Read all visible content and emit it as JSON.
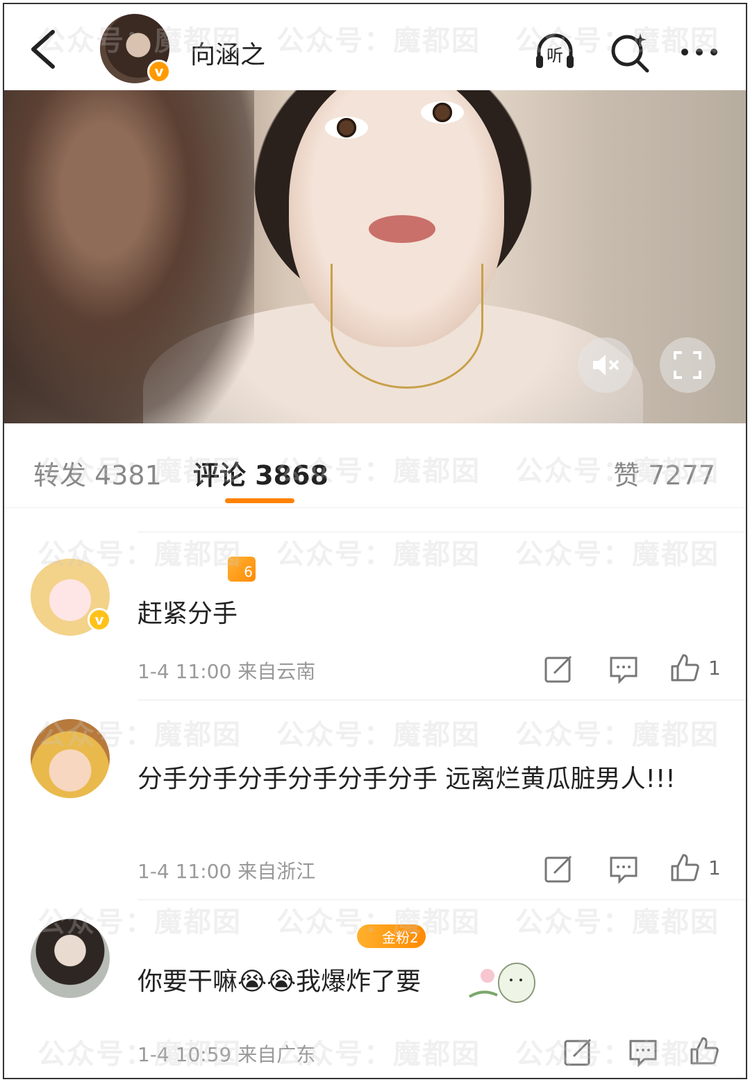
{
  "header": {
    "title": "向涵之",
    "verified_badge": "v",
    "listen_label": "听",
    "icons": [
      "back-chevron-icon",
      "listen-headphone-icon",
      "search-sparkle-icon",
      "more-dots-icon"
    ]
  },
  "video": {
    "controls": [
      "mute-icon",
      "fullscreen-icon"
    ]
  },
  "tabs": {
    "repost": "转发 4381",
    "comments": "评论 3868",
    "likes": "赞 7277"
  },
  "comments": [
    {
      "text": "赶紧分手",
      "meta": "1-4 11:00  来自云南",
      "like_count": "1",
      "level_badge": "6",
      "verified_badge": "v"
    },
    {
      "text": "分手分手分手分手分手分手 远离烂黄瓜脏男人!!!",
      "meta": "1-4 11:00  来自浙江",
      "like_count": "1"
    },
    {
      "text": "你要干嘛😭😭我爆炸了要",
      "meta": "1-4 10:59  来自广东",
      "fan_badge": "金粉2",
      "like_count": ""
    }
  ],
  "watermark": "公众号：魔都囡",
  "colors": {
    "accent": "#ff8200",
    "verified": "#ff9a00",
    "meta_text": "#999999"
  }
}
